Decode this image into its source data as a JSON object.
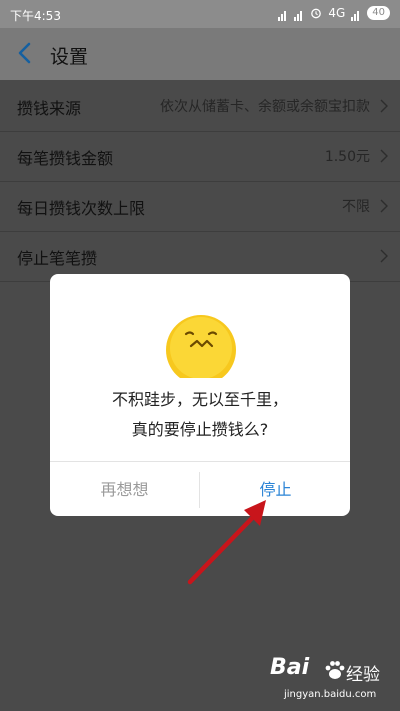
{
  "status_bar": {
    "time": "下午4:53",
    "network": "4G",
    "battery": "40"
  },
  "header": {
    "title": "设置"
  },
  "settings": [
    {
      "label": "攒钱来源",
      "value": "依次从储蓄卡、余额或余额宝扣款"
    },
    {
      "label": "每笔攒钱金额",
      "value": "1.50元"
    },
    {
      "label": "每日攒钱次数上限",
      "value": "不限"
    },
    {
      "label": "停止笔笔攒",
      "value": ""
    }
  ],
  "dialog": {
    "message_line1": "不积跬步，无以至千里，",
    "message_line2": "真的要停止攒钱么?",
    "cancel_label": "再想想",
    "stop_label": "停止"
  },
  "watermark": {
    "brand": "Bai",
    "brand_sub": "经验",
    "url": "jingyan.baidu.com"
  },
  "colors": {
    "accent": "#2b84d6",
    "arrow": "#c8151b",
    "emoji": "#f7c81e"
  }
}
